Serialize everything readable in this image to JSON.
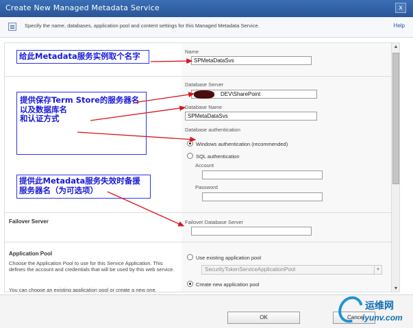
{
  "window": {
    "title": "Create New Managed Metadata Service",
    "close_glyph": "x"
  },
  "header": {
    "description": "Specify the name, databases, application pool and content settings for this Managed Metadata Service.",
    "help_label": "Help"
  },
  "form": {
    "name_label": "Name",
    "name_value": "SPMetaDataSvs",
    "db_server_label": "Database Server",
    "db_server_value": "DEV\\SharePoint",
    "db_name_label": "Database Name",
    "db_name_value": "SPMetaDataSvs",
    "db_auth_label": "Database authentication",
    "auth_windows": "Windows authentication (recommended)",
    "auth_sql": "SQL authentication",
    "account_label": "Account",
    "account_value": "",
    "password_label": "Password",
    "password_value": "",
    "auth_selected": "windows",
    "failover_section_title": "Failover Server",
    "failover_label": "Failover Database Server",
    "failover_value": "",
    "app_pool_section_title": "Application Pool",
    "app_pool_desc_1": "Choose the Application Pool to use for this Service Application. This defines the account and credentials that will be used by this web service.",
    "app_pool_desc_2": "You can choose an existing application pool or create a new one.",
    "use_existing_label": "Use existing application pool",
    "existing_pool_value": "SecurityTokenServiceApplicationPool",
    "create_new_label": "Create new application pool",
    "pool_selected": "create"
  },
  "annotations": {
    "name_note": "给此Metadata服务实例取个名字",
    "db_note": "提供保存Term Store的服务器名\n以及数据库名\n和认证方式",
    "failover_note": "提供此Metadata服务失效时备援\n服务器名（为可选项）"
  },
  "footer": {
    "ok_label": "OK",
    "cancel_label": "Cancel"
  },
  "watermark": {
    "zh": "运维网",
    "en": "iyunv.com"
  },
  "colors": {
    "title_bar": "#2f5fa6",
    "annotation": "#1919d8",
    "arrow": "#d8141c"
  }
}
